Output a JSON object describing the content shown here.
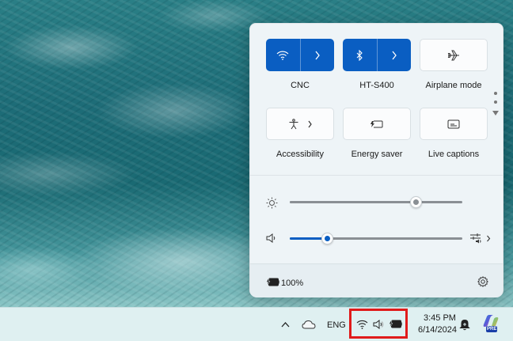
{
  "quick_settings": {
    "tiles": [
      {
        "label": "CNC",
        "icon": "wifi-icon",
        "state": "on",
        "has_arrow": true
      },
      {
        "label": "HT-S400",
        "icon": "bluetooth-icon",
        "state": "on",
        "has_arrow": true
      },
      {
        "label": "Airplane mode",
        "icon": "airplane-icon",
        "state": "off",
        "has_arrow": false
      },
      {
        "label": "Accessibility",
        "icon": "accessibility-icon",
        "state": "off",
        "has_arrow": true
      },
      {
        "label": "Energy saver",
        "icon": "energy-saver-icon",
        "state": "off",
        "has_arrow": false
      },
      {
        "label": "Live captions",
        "icon": "live-captions-icon",
        "state": "off",
        "has_arrow": false
      }
    ],
    "brightness": {
      "icon": "brightness-icon",
      "level": 0.73
    },
    "volume": {
      "icon": "speaker-icon",
      "level": 0.22,
      "output_icon": "audio-output-icon"
    },
    "footer": {
      "battery_text": "100%",
      "battery_icon": "battery-charging-icon",
      "settings_icon": "gear-icon"
    }
  },
  "taskbar": {
    "chevron_icon": "chevron-up-icon",
    "weather_icon": "cloud-icon",
    "language": "ENG",
    "tray_icons": [
      "wifi-icon",
      "speaker-icon",
      "battery-charging-icon"
    ],
    "time": "3:45 PM",
    "date": "6/14/2024",
    "notification_icon": "notification-bell-icon",
    "copilot_icon": "copilot-icon",
    "copilot_badge": "PRE"
  },
  "colors": {
    "accent": "#0a5ec2",
    "highlight_box": "#e01b1b"
  }
}
